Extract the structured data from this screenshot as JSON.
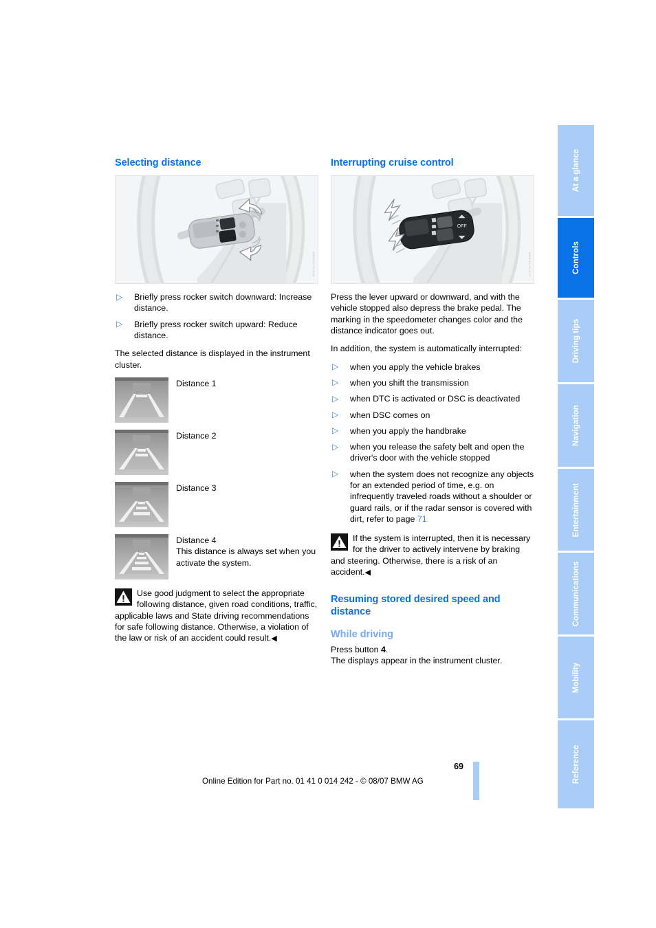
{
  "left_column": {
    "section_title": "Selecting distance",
    "illustration_name": "steering-wheel-rocker-switch",
    "bullets": [
      "Briefly press rocker switch downward: Increase distance.",
      "Briefly press rocker switch upward: Reduce distance."
    ],
    "intro_text": "The selected distance is displayed in the instrument cluster.",
    "distances": [
      {
        "label": "Distance 1",
        "note": "",
        "bars": 1
      },
      {
        "label": "Distance 2",
        "note": "",
        "bars": 2
      },
      {
        "label": "Distance 3",
        "note": "",
        "bars": 3
      },
      {
        "label": "Distance 4",
        "note": "This distance is always set when you activate the system.",
        "bars": 4
      }
    ],
    "warning": {
      "icon": "warning-triangle-icon",
      "text": "Use good judgment to select the appropriate following distance, given road conditions, traffic, applicable laws and State driving recommendations for safe following distance. Otherwise, a violation of the law or risk of an accident could result.",
      "end_marker": "◀"
    }
  },
  "right_column": {
    "section_title": "Interrupting cruise control",
    "illustration_name": "steering-wheel-lever-up-down",
    "paragraph_1": "Press the lever upward or downward, and with the vehicle stopped also depress the brake pedal. The marking in the speedometer changes color and the distance indicator goes out.",
    "paragraph_2": "In addition, the system is automatically interrupted:",
    "bullets": [
      "when you apply the vehicle brakes",
      "when you shift the transmission",
      "when DTC is activated or DSC is deactivated",
      "when DSC comes on",
      "when you apply the handbrake",
      "when you release the safety belt and open the driver's door with the vehicle stopped"
    ],
    "bullet_last_prefix": "when the system does not recognize any objects for an extended period of time, e.g. on infrequently traveled roads without a shoulder or guard rails, or if the radar sensor is covered with dirt, refer to page ",
    "bullet_last_page_ref": "71",
    "warning": {
      "icon": "warning-triangle-icon",
      "text": "If the system is interrupted, then it is necessary for the driver to actively intervene by braking and steering. Otherwise, there is a risk of an accident.",
      "end_marker": "◀"
    },
    "resume_title": "Resuming stored desired speed and distance",
    "while_driving_title": "While driving",
    "resume_line_1_prefix": "Press button ",
    "resume_line_1_bold": "4",
    "resume_line_1_suffix": ".",
    "resume_line_2": "The displays appear in the instrument cluster."
  },
  "tabs": [
    {
      "label": "At a glance",
      "active": false
    },
    {
      "label": "Controls",
      "active": true
    },
    {
      "label": "Driving tips",
      "active": false
    },
    {
      "label": "Navigation",
      "active": false
    },
    {
      "label": "Entertainment",
      "active": false
    },
    {
      "label": "Communications",
      "active": false
    },
    {
      "label": "Mobility",
      "active": false
    },
    {
      "label": "Reference",
      "active": false
    }
  ],
  "footer": {
    "page_number": "69",
    "edition_text": "Online Edition for Part no. 01 41 0 014 242 - © 08/07 BMW AG"
  },
  "colors": {
    "heading_blue": "#0a72e8",
    "subheading_blue": "#74aaf0",
    "tab_inactive": "#aacdf7",
    "tab_active": "#0a72e8",
    "bullet_blue": "#2e8bf5"
  }
}
